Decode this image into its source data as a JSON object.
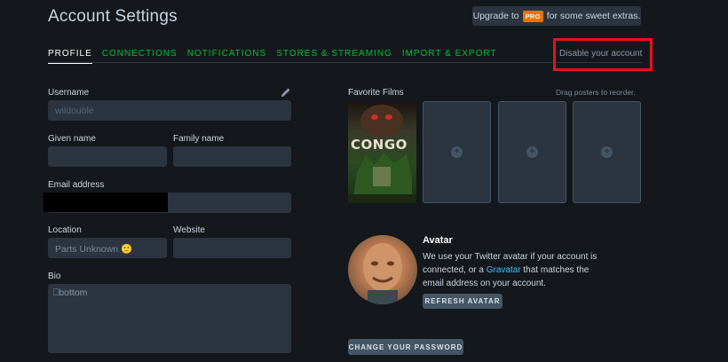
{
  "header": {
    "title": "Account Settings",
    "upgrade_prefix": "Upgrade to",
    "upgrade_badge": "PRO",
    "upgrade_suffix": "for some sweet extras."
  },
  "tabs": [
    {
      "label": "PROFILE",
      "active": true
    },
    {
      "label": "CONNECTIONS",
      "active": false
    },
    {
      "label": "NOTIFICATIONS",
      "active": false
    },
    {
      "label": "STORES & STREAMING",
      "active": false
    },
    {
      "label": "IMPORT & EXPORT",
      "active": false
    }
  ],
  "disable_account": "Disable your account",
  "form": {
    "username_label": "Username",
    "username_value": "wildouble",
    "given_name_label": "Given name",
    "given_name_value": "",
    "family_name_label": "Family name",
    "family_name_value": "",
    "email_label": "Email address",
    "location_label": "Location",
    "location_value": "Parts Unknown 🙂",
    "website_label": "Website",
    "website_value": "",
    "bio_label": "Bio",
    "bio_value": "⎕bottom"
  },
  "favorites": {
    "label": "Favorite Films",
    "hint": "Drag posters to reorder.",
    "poster_title": "CONGO",
    "empty_slot_glyph": "+"
  },
  "avatar": {
    "title": "Avatar",
    "desc_part1": "We use your Twitter avatar if your account is connected, or a",
    "desc_link": "Gravatar",
    "desc_part2": "that matches the email address on your account.",
    "refresh_label": "REFRESH AVATAR"
  },
  "change_password_label": "CHANGE YOUR PASSWORD",
  "colors": {
    "background": "#14181c",
    "tab_green": "#00c030",
    "field_bg": "#2c3440",
    "pro_orange": "#ee7000",
    "link_blue": "#40bcf4",
    "highlight_red": "#e0141c"
  }
}
